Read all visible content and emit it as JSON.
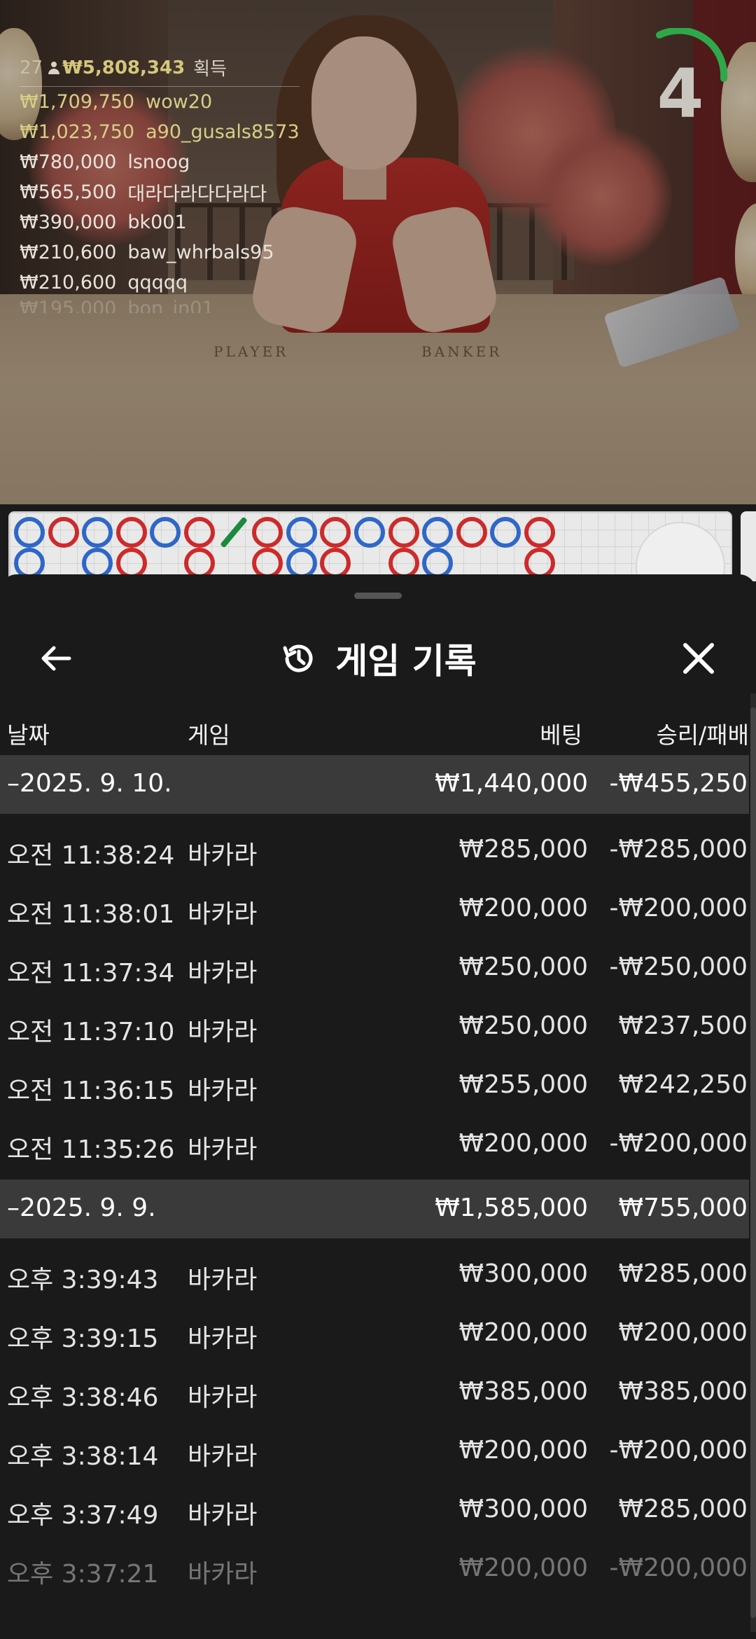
{
  "leaderboard": {
    "player_count": "27",
    "total": "₩5,808,343",
    "earned_label": "획득",
    "rows": [
      {
        "amount": "₩1,709,750",
        "name": "wow20"
      },
      {
        "amount": "₩1,023,750",
        "name": "a90_gusals8573"
      },
      {
        "amount": "₩780,000",
        "name": "lsnoog"
      },
      {
        "amount": "₩565,500",
        "name": "대라다라다다라다"
      },
      {
        "amount": "₩390,000",
        "name": "bk001"
      },
      {
        "amount": "₩210,600",
        "name": "baw_whrbals95"
      },
      {
        "amount": "₩210,600",
        "name": "qqqqq"
      },
      {
        "amount": "₩195,000",
        "name": "bon_in01"
      }
    ]
  },
  "timer": {
    "value": "4",
    "color": "#2ea84a"
  },
  "table_labels": {
    "player": "PLAYER",
    "banker": "BANKER"
  },
  "panel": {
    "title": "게임 기록",
    "columns": {
      "date": "날짜",
      "game": "게임",
      "bet": "베팅",
      "result": "승리/패배"
    },
    "days": [
      {
        "date": "–2025. 9. 10.",
        "bet": "₩1,440,000",
        "result": "-₩455,250",
        "rows": [
          {
            "time": "오전 11:38:24",
            "game": "바카라",
            "bet": "₩285,000",
            "result": "-₩285,000"
          },
          {
            "time": "오전 11:38:01",
            "game": "바카라",
            "bet": "₩200,000",
            "result": "-₩200,000"
          },
          {
            "time": "오전 11:37:34",
            "game": "바카라",
            "bet": "₩250,000",
            "result": "-₩250,000"
          },
          {
            "time": "오전 11:37:10",
            "game": "바카라",
            "bet": "₩250,000",
            "result": "₩237,500"
          },
          {
            "time": "오전 11:36:15",
            "game": "바카라",
            "bet": "₩255,000",
            "result": "₩242,250"
          },
          {
            "time": "오전 11:35:26",
            "game": "바카라",
            "bet": "₩200,000",
            "result": "-₩200,000"
          }
        ]
      },
      {
        "date": "–2025. 9. 9.",
        "bet": "₩1,585,000",
        "result": "₩755,000",
        "rows": [
          {
            "time": "오후 3:39:43",
            "game": "바카라",
            "bet": "₩300,000",
            "result": "₩285,000"
          },
          {
            "time": "오후 3:39:15",
            "game": "바카라",
            "bet": "₩200,000",
            "result": "₩200,000"
          },
          {
            "time": "오후 3:38:46",
            "game": "바카라",
            "bet": "₩385,000",
            "result": "₩385,000"
          },
          {
            "time": "오후 3:38:14",
            "game": "바카라",
            "bet": "₩200,000",
            "result": "-₩200,000"
          },
          {
            "time": "오후 3:37:49",
            "game": "바카라",
            "bet": "₩300,000",
            "result": "₩285,000"
          },
          {
            "time": "오후 3:37:21",
            "game": "바카라",
            "bet": "₩200,000",
            "result": "-₩200,000"
          }
        ]
      }
    ]
  },
  "roadmap": {
    "top_row": [
      "B",
      "P",
      "B",
      "P",
      "B",
      "P",
      "T",
      "P",
      "B",
      "P",
      "B",
      "P",
      "B",
      "P",
      "B",
      "P"
    ],
    "bottom_row": [
      "B",
      "",
      "B",
      "P",
      "",
      "P",
      "",
      "P",
      "B",
      "P",
      "",
      "P",
      "B",
      "",
      "",
      "P"
    ],
    "colors": {
      "banker": "#2f67c7",
      "player": "#cc2b2b",
      "tie": "#1c8a3e"
    }
  },
  "icons": {
    "back": "arrow-left-icon",
    "history": "history-icon",
    "close": "close-icon",
    "expand": "chevron-up-double-icon"
  }
}
